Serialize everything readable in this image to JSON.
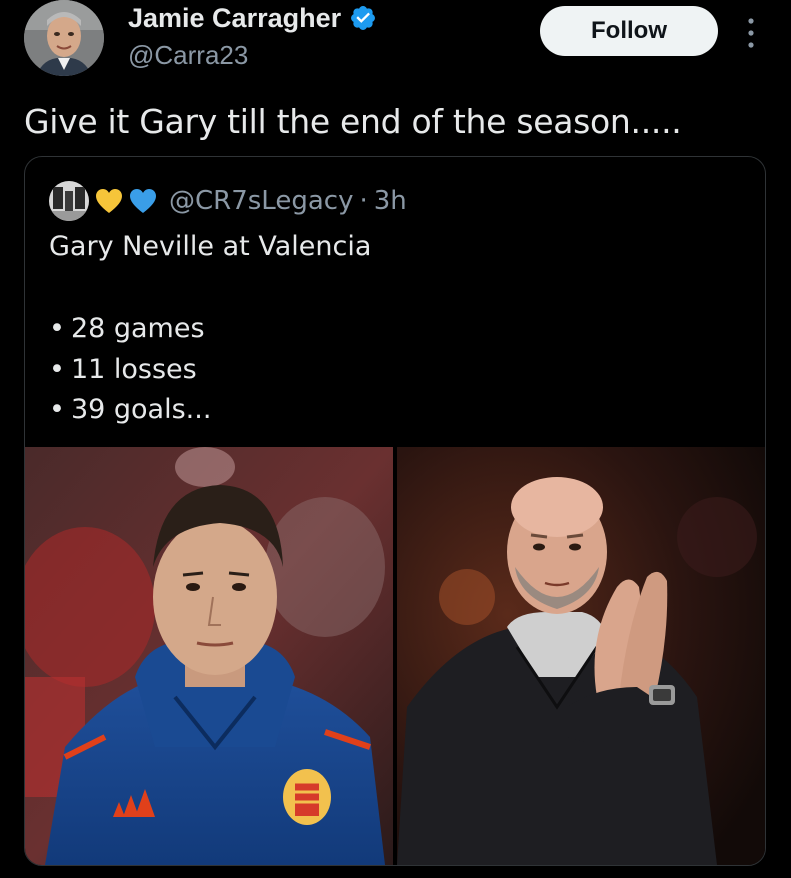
{
  "author": {
    "display_name": "Jamie Carragher",
    "handle": "@Carra23",
    "verified": true,
    "verified_color": "#1d9bf0"
  },
  "follow_label": "Follow",
  "more_icon": "more-vertical-icon",
  "tweet_text": "Give it Gary till the end of the season.....",
  "quoted_tweet": {
    "emoji": [
      "yellow-heart-icon",
      "blue-heart-icon"
    ],
    "handle": "@CR7sLegacy",
    "separator": "·",
    "time": "3h",
    "title": "Gary Neville at Valencia",
    "stats": [
      "28 games",
      "11 losses",
      "39 goals..."
    ],
    "images": [
      "gary-neville-valencia-photo",
      "erik-ten-hag-applauding-photo"
    ]
  },
  "colors": {
    "background": "#000000",
    "text": "#e7e9ea",
    "secondary_text": "#8b98a5",
    "border": "#2f3336",
    "follow_bg": "#eff3f4"
  }
}
